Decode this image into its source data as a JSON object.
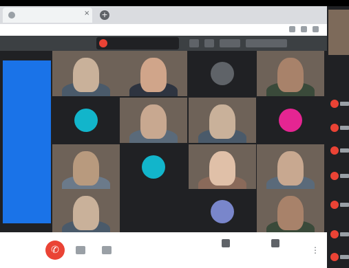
{
  "browser": {
    "tab_title": "",
    "tab_close": "×",
    "new_tab": "+"
  },
  "meet": {
    "presenter_name": "",
    "slide_text": "",
    "tiles": [
      {
        "kind": "video",
        "name": ""
      },
      {
        "kind": "video",
        "name": ""
      },
      {
        "kind": "avatar",
        "initial": "",
        "color": "#5f6368",
        "name": ""
      },
      {
        "kind": "video",
        "name": ""
      },
      {
        "kind": "avatar",
        "initial": "",
        "color": "#12b5cb",
        "name": ""
      },
      {
        "kind": "video",
        "name": ""
      },
      {
        "kind": "video",
        "name": ""
      },
      {
        "kind": "avatar",
        "initial": "",
        "color": "#e52592",
        "name": ""
      },
      {
        "kind": "video",
        "name": ""
      },
      {
        "kind": "avatar",
        "initial": "",
        "color": "#12b5cb",
        "name": ""
      },
      {
        "kind": "video",
        "name": ""
      },
      {
        "kind": "video",
        "name": ""
      },
      {
        "kind": "video",
        "name": ""
      },
      {
        "kind": "dark",
        "name": ""
      },
      {
        "kind": "avatar",
        "initial": "",
        "color": "#7986cb",
        "name": ""
      },
      {
        "kind": "video",
        "name": ""
      }
    ]
  },
  "controls": {
    "end_call_icon": "phone-hangup-icon",
    "end_call_glyph": "✆",
    "more_glyph": "⋮",
    "caption_label": "",
    "present_label": ""
  },
  "colors": {
    "accent_blue": "#1a73e8",
    "end_call_red": "#ea4335",
    "meet_background": "#202124"
  }
}
